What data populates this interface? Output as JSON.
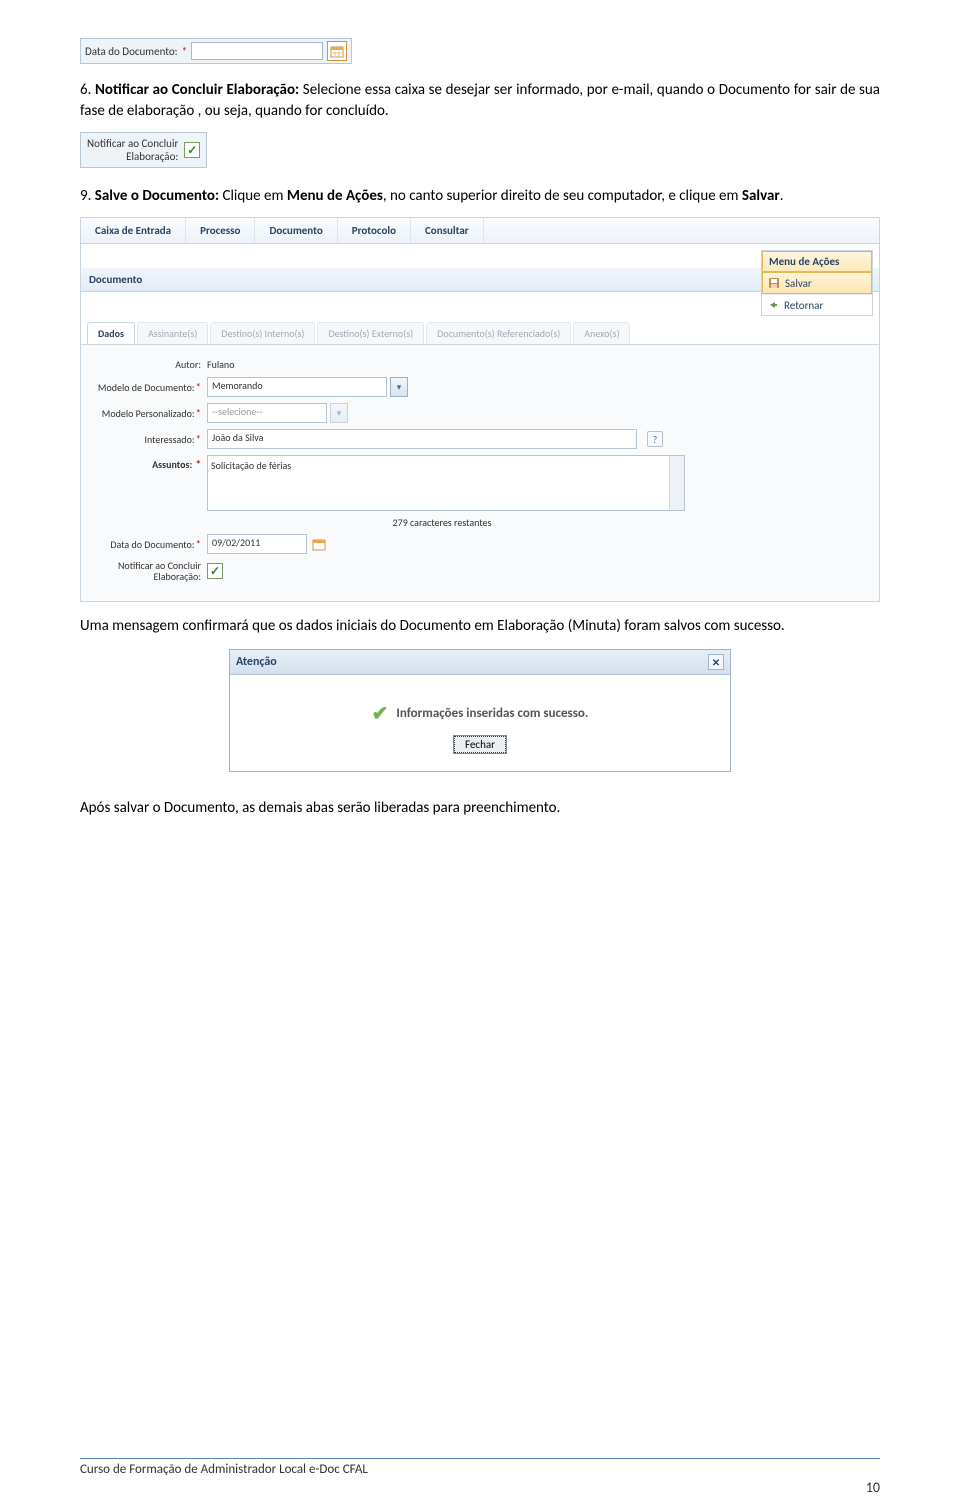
{
  "topField": {
    "label": "Data do Documento:",
    "value": ""
  },
  "para6": {
    "prefix": "6. ",
    "bold": "Notificar ao Concluir Elaboração:",
    "rest": " Selecione essa caixa se desejar ser informado, por e-mail, quando o Documento for sair de sua fase de elaboração , ou seja, quando for concluído."
  },
  "notifyBox": {
    "line1": "Notificar ao Concluir",
    "line2": "Elaboração:"
  },
  "para9": {
    "prefix": "9. ",
    "bold1": "Salve o Documento:",
    "mid1": " Clique em ",
    "bold2": "Menu de Ações",
    "mid2": ", no canto superior direito de seu computador, e clique em ",
    "bold3": "Salvar",
    "end": "."
  },
  "app": {
    "menu": [
      "Caixa de Entrada",
      "Processo",
      "Documento",
      "Protocolo",
      "Consultar"
    ],
    "actions": {
      "head": "Menu de Ações",
      "salvar": "Salvar",
      "retornar": "Retornar"
    },
    "docHead": "Documento",
    "tabs": [
      "Dados",
      "Assinante(s)",
      "Destino(s) Interno(s)",
      "Destino(s) Externo(s)",
      "Documento(s) Referenciado(s)",
      "Anexo(s)"
    ],
    "form": {
      "autor": {
        "label": "Autor:",
        "value": "Fulano"
      },
      "modeloDoc": {
        "label": "Modelo de Documento:",
        "value": "Memorando"
      },
      "modeloPers": {
        "label": "Modelo Personalizado:",
        "value": "--selecione--"
      },
      "interessado": {
        "label": "Interessado:",
        "value": "João da Silva"
      },
      "assuntos": {
        "label": "Assuntos:",
        "value": "Solicitação de férias"
      },
      "charCount": "279 caracteres restantes",
      "dataDoc": {
        "label": "Data do Documento:",
        "value": "09/02/2011"
      },
      "notificar": {
        "label1": "Notificar ao Concluir",
        "label2": "Elaboração:"
      }
    }
  },
  "paraConfirm": "Uma mensagem confirmará que os dados iniciais do Documento em Elaboração (Minuta) foram salvos com sucesso.",
  "dialog": {
    "title": "Atenção",
    "msg": "Informações inseridas com sucesso.",
    "btn": "Fechar"
  },
  "paraAfter": "Após salvar o Documento, as demais abas serão liberadas para preenchimento.",
  "footer": "Curso de Formação de Administrador Local e-Doc CFAL",
  "pageNum": "10"
}
